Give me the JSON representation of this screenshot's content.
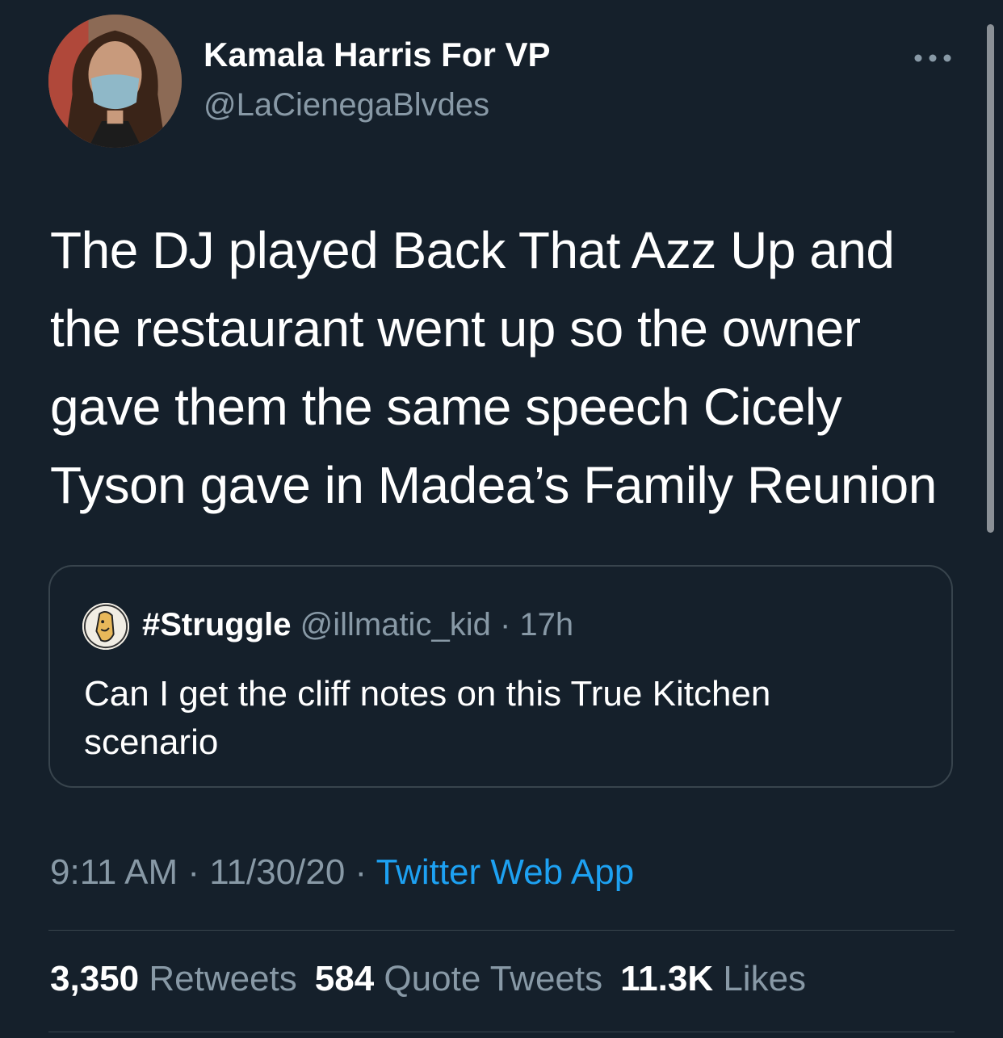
{
  "user": {
    "display_name": "Kamala Harris For VP",
    "handle": "@LaCienegaBlvdes"
  },
  "tweet": {
    "text_lines": [
      "The DJ played Back That Azz Up and",
      "the restaurant went up so the owner",
      "gave them the same speech Cicely",
      "Tyson gave in Madea’s Family Reunion"
    ]
  },
  "quoted": {
    "name": "#Struggle",
    "handle": "@illmatic_kid",
    "dot": " · ",
    "time": "17h",
    "text_lines": [
      "Can I get the cliff notes on this True Kitchen",
      "scenario"
    ]
  },
  "meta": {
    "time": "9:11 AM",
    "sep1": " · ",
    "date": "11/30/20",
    "sep2": " · ",
    "source": "Twitter Web App"
  },
  "stats": {
    "retweets_count": "3,350",
    "retweets_label": "Retweets",
    "quotes_count": "584",
    "quotes_label": "Quote Tweets",
    "likes_count": "11.3K",
    "likes_label": "Likes"
  },
  "icons": {
    "more": "more-horizontal-icon"
  },
  "colors": {
    "background": "#15202b",
    "secondary_text": "#8899a6",
    "link": "#1da1f2",
    "border": "#38444d"
  }
}
